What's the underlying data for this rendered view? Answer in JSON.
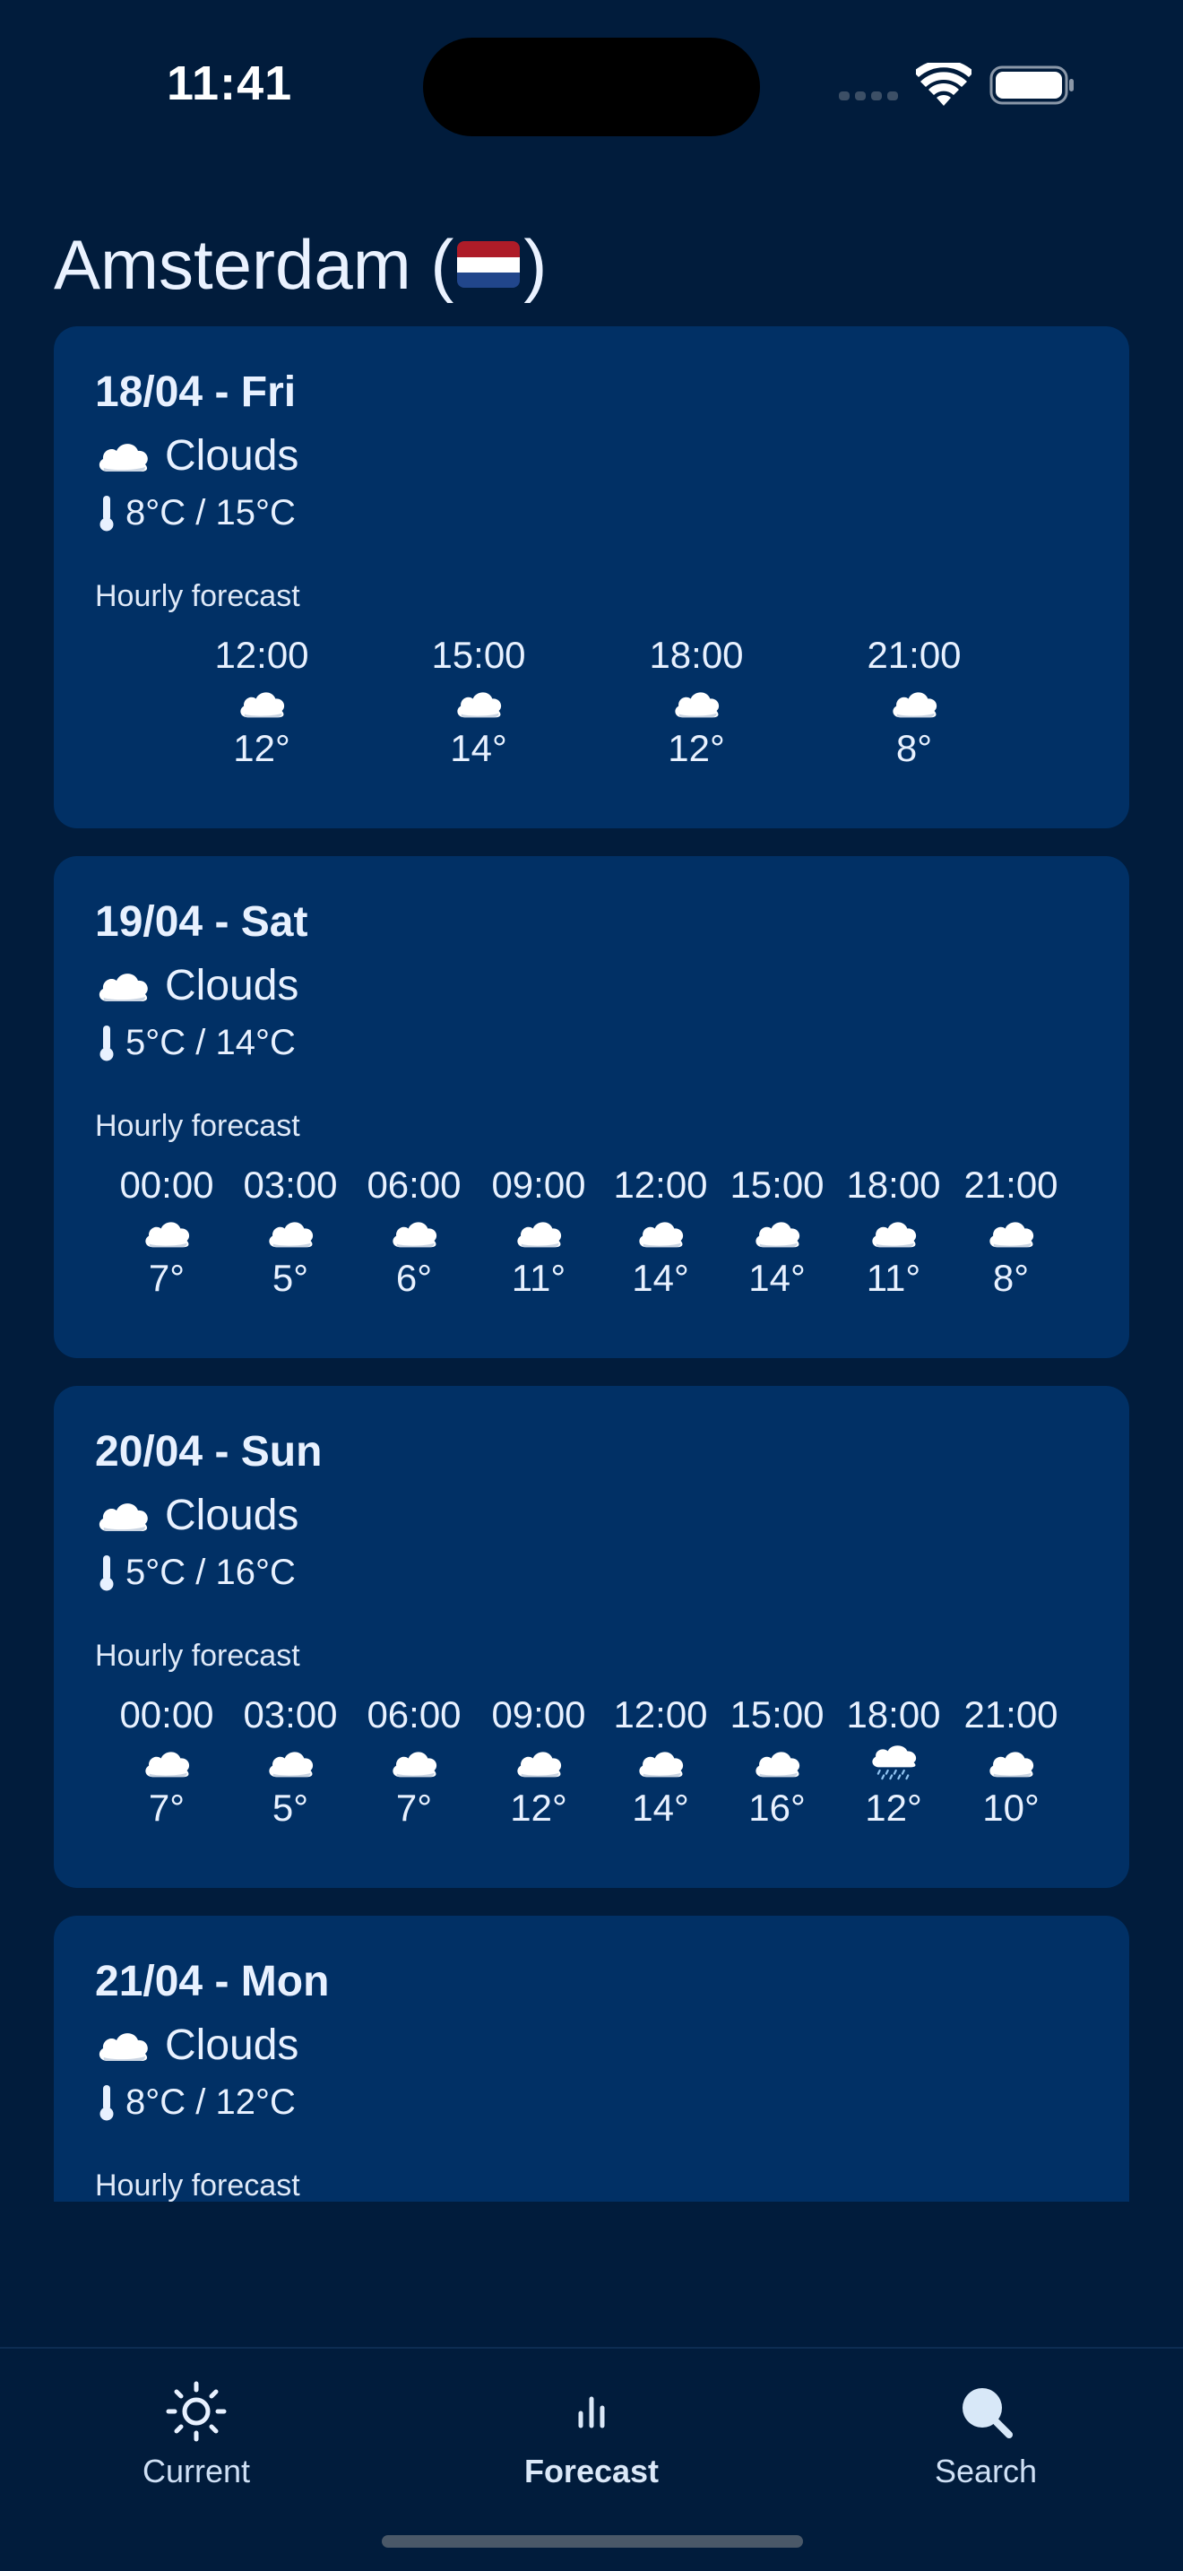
{
  "status_bar": {
    "time": "11:41"
  },
  "header": {
    "city": "Amsterdam (",
    "city_close": ")",
    "flag_colors": [
      "#ae1c28",
      "#ffffff",
      "#21468b"
    ]
  },
  "forecast": [
    {
      "date": "18/04 - Fri",
      "condition": "Clouds",
      "condition_icon": "cloud-icon",
      "temp_range": "8°C / 15°C",
      "hourly_label": "Hourly forecast",
      "hours": [
        {
          "time": "12:00",
          "icon": "cloud",
          "temp": "12°"
        },
        {
          "time": "15:00",
          "icon": "cloud",
          "temp": "14°"
        },
        {
          "time": "18:00",
          "icon": "cloud",
          "temp": "12°"
        },
        {
          "time": "21:00",
          "icon": "cloud",
          "temp": "8°"
        }
      ]
    },
    {
      "date": "19/04 - Sat",
      "condition": "Clouds",
      "condition_icon": "cloud-icon",
      "temp_range": "5°C / 14°C",
      "hourly_label": "Hourly forecast",
      "hours": [
        {
          "time": "00:00",
          "icon": "cloud",
          "temp": "7°"
        },
        {
          "time": "03:00",
          "icon": "cloud",
          "temp": "5°"
        },
        {
          "time": "06:00",
          "icon": "cloud",
          "temp": "6°"
        },
        {
          "time": "09:00",
          "icon": "cloud",
          "temp": "11°"
        },
        {
          "time": "12:00",
          "icon": "cloud",
          "temp": "14°"
        },
        {
          "time": "15:00",
          "icon": "cloud",
          "temp": "14°"
        },
        {
          "time": "18:00",
          "icon": "cloud",
          "temp": "11°"
        },
        {
          "time": "21:00",
          "icon": "cloud",
          "temp": "8°"
        }
      ]
    },
    {
      "date": "20/04 - Sun",
      "condition": "Clouds",
      "condition_icon": "cloud-icon",
      "temp_range": "5°C / 16°C",
      "hourly_label": "Hourly forecast",
      "hours": [
        {
          "time": "00:00",
          "icon": "cloud",
          "temp": "7°"
        },
        {
          "time": "03:00",
          "icon": "cloud",
          "temp": "5°"
        },
        {
          "time": "06:00",
          "icon": "cloud",
          "temp": "7°"
        },
        {
          "time": "09:00",
          "icon": "cloud",
          "temp": "12°"
        },
        {
          "time": "12:00",
          "icon": "cloud",
          "temp": "14°"
        },
        {
          "time": "15:00",
          "icon": "cloud",
          "temp": "16°"
        },
        {
          "time": "18:00",
          "icon": "rain",
          "temp": "12°"
        },
        {
          "time": "21:00",
          "icon": "cloud",
          "temp": "10°"
        }
      ]
    },
    {
      "date": "21/04 - Mon",
      "condition": "Clouds",
      "condition_icon": "cloud-icon",
      "temp_range": "8°C / 12°C",
      "hourly_label": "Hourly forecast",
      "hours": []
    }
  ],
  "tab_bar": {
    "tabs": [
      {
        "label": "Current",
        "icon": "sun-icon",
        "active": false
      },
      {
        "label": "Forecast",
        "icon": "bar-chart-icon",
        "active": true
      },
      {
        "label": "Search",
        "icon": "search-icon",
        "active": false
      }
    ]
  },
  "colors": {
    "background": "#011c3c",
    "card": "#013065",
    "text": "#e8f1ff"
  }
}
